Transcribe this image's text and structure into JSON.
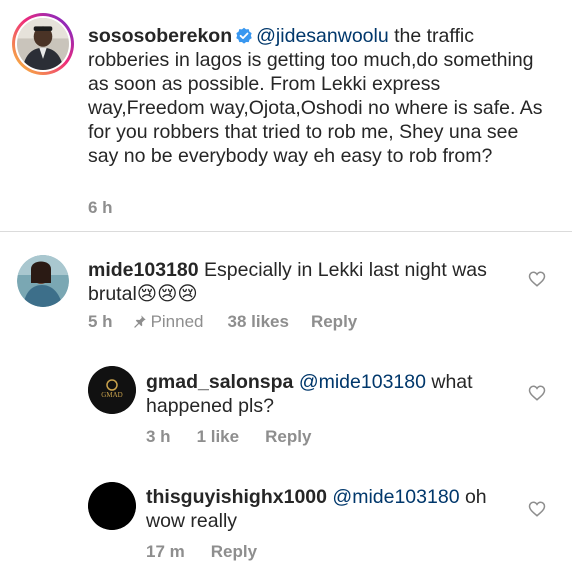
{
  "post": {
    "username": "sososoberekon",
    "mention": "@jidesanwoolu",
    "text": " the traffic robberies in lagos is getting too much,do something as soon as possible. From Lekki express way,Freedom way,Ojota,Oshodi no where is safe. As for you robbers that tried to rob me, Shey una see say no be everybody way eh easy to rob from?",
    "time": "6 h"
  },
  "comments": [
    {
      "username": "mide103180",
      "mention": "",
      "text": " Especially in Lekki last night was brutal😢😢😢",
      "time": "5 h",
      "pinned": "Pinned",
      "likes": "38 likes",
      "reply": "Reply"
    },
    {
      "username": "gmad_salonspa",
      "mention": "@mide103180",
      "text": " what happened pls?",
      "time": "3 h",
      "likes": "1 like",
      "reply": "Reply",
      "avatar_text": "GMAD"
    },
    {
      "username": "thisguyishighx1000",
      "mention": "@mide103180",
      "text": " oh wow really",
      "time": "17 m",
      "reply": "Reply"
    }
  ],
  "colors": {
    "text": "#262626",
    "muted": "#8e8e8e",
    "mention": "#00376b",
    "verified": "#3897f0",
    "divider": "#dbdbdb"
  }
}
